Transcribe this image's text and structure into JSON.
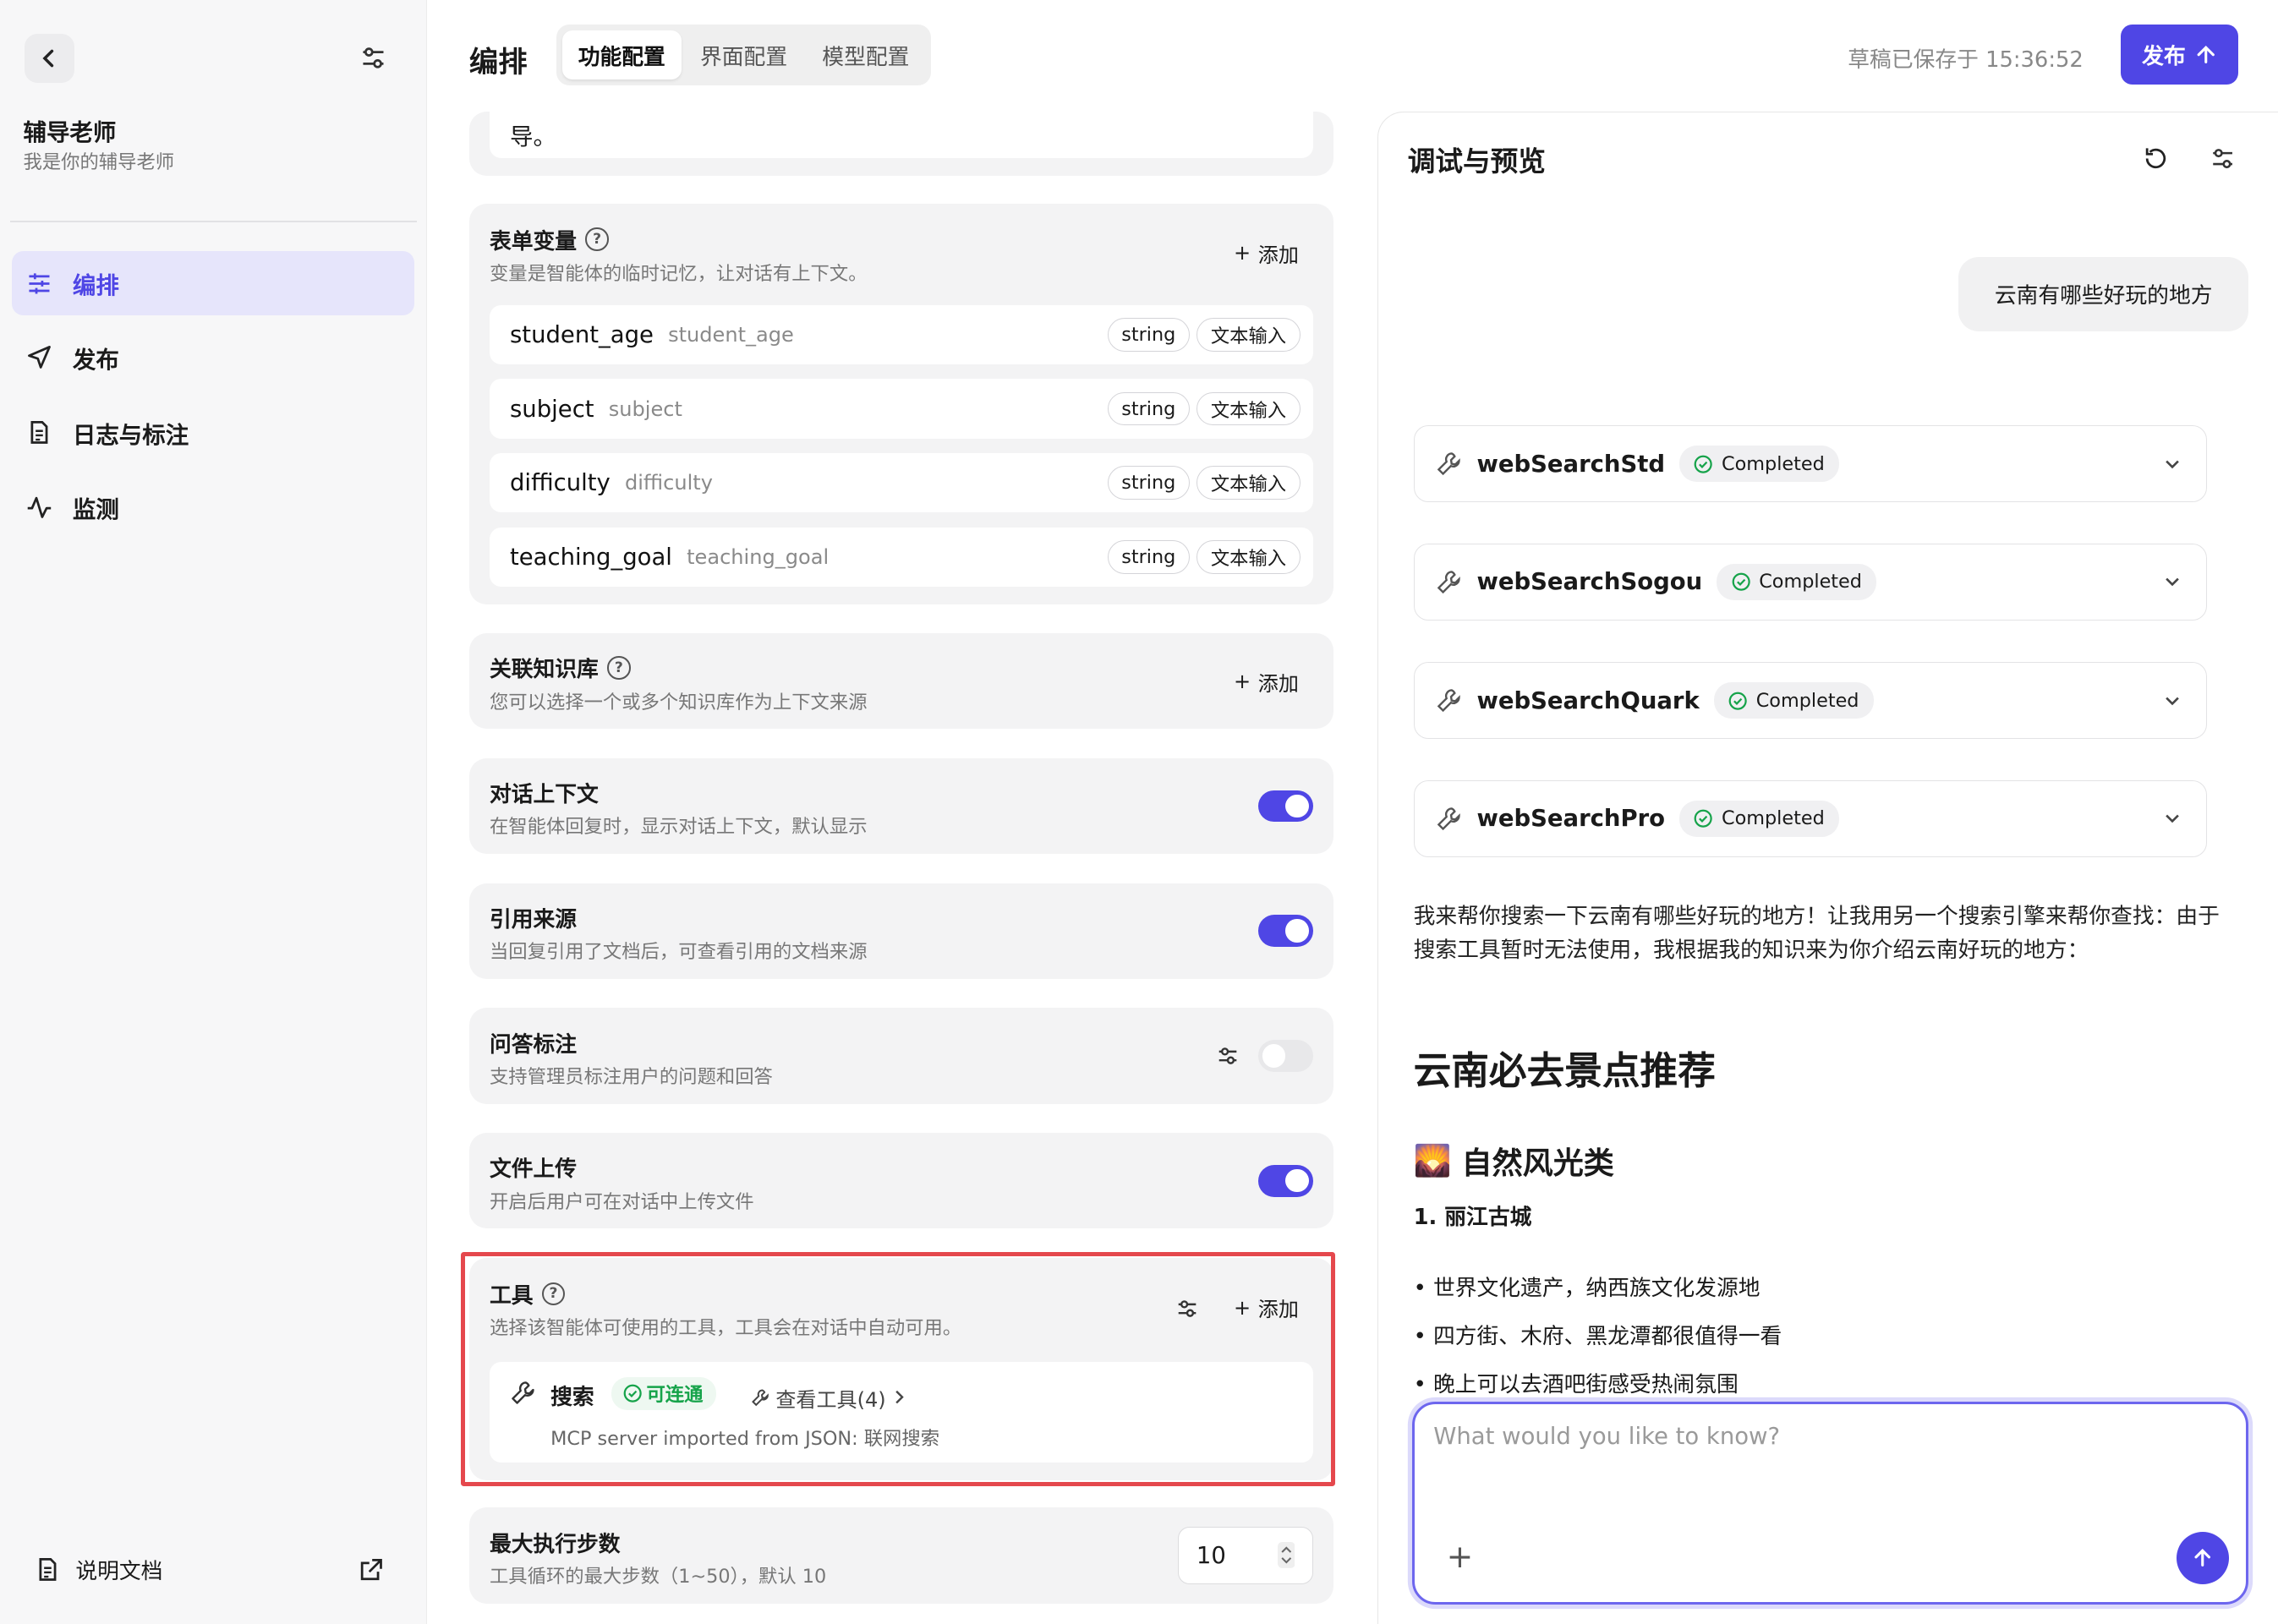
{
  "sidebar": {
    "agent_name": "辅导老师",
    "agent_desc": "我是你的辅导老师",
    "nav": [
      {
        "label": "编排",
        "icon": "sliders-icon",
        "active": true
      },
      {
        "label": "发布",
        "icon": "send-icon",
        "active": false
      },
      {
        "label": "日志与标注",
        "icon": "document-icon",
        "active": false
      },
      {
        "label": "监测",
        "icon": "activity-icon",
        "active": false
      }
    ],
    "doc_link": "说明文档"
  },
  "header": {
    "title": "编排",
    "tabs": [
      "功能配置",
      "界面配置",
      "模型配置"
    ],
    "active_tab": "功能配置",
    "saved_text": "草稿已保存于 15:36:52",
    "publish_label": "发布"
  },
  "config": {
    "prompt_tail": "导。",
    "form_vars": {
      "title": "表单变量",
      "subtitle": "变量是智能体的临时记忆，让对话有上下文。",
      "add_label": "添加",
      "rows": [
        {
          "key": "student_age",
          "label": "student_age",
          "type": "string",
          "input": "文本输入"
        },
        {
          "key": "subject",
          "label": "subject",
          "type": "string",
          "input": "文本输入"
        },
        {
          "key": "difficulty",
          "label": "difficulty",
          "type": "string",
          "input": "文本输入"
        },
        {
          "key": "teaching_goal",
          "label": "teaching_goal",
          "type": "string",
          "input": "文本输入"
        }
      ]
    },
    "knowledge": {
      "title": "关联知识库",
      "subtitle": "您可以选择一个或多个知识库作为上下文来源",
      "add_label": "添加"
    },
    "context": {
      "title": "对话上下文",
      "subtitle": "在智能体回复时，显示对话上下文，默认显示",
      "enabled": true
    },
    "citation": {
      "title": "引用来源",
      "subtitle": "当回复引用了文档后，可查看引用的文档来源",
      "enabled": true
    },
    "annotation": {
      "title": "问答标注",
      "subtitle": "支持管理员标注用户的问题和回答",
      "enabled": false
    },
    "upload": {
      "title": "文件上传",
      "subtitle": "开启后用户可在对话中上传文件",
      "enabled": true
    },
    "tools": {
      "title": "工具",
      "subtitle": "选择该智能体可使用的工具，工具会在对话中自动可用。",
      "add_label": "添加",
      "item": {
        "name": "搜索",
        "status": "可连通",
        "view_tools": "查看工具(4)",
        "description": "MCP server imported from JSON: 联网搜索"
      }
    },
    "max_steps": {
      "title": "最大执行步数",
      "subtitle": "工具循环的最大步数（1~50），默认 10",
      "value": "10"
    }
  },
  "preview": {
    "title": "调试与预览",
    "user_message": "云南有哪些好玩的地方",
    "tool_calls": [
      {
        "name": "webSearchStd",
        "status": "Completed"
      },
      {
        "name": "webSearchSogou",
        "status": "Completed"
      },
      {
        "name": "webSearchQuark",
        "status": "Completed"
      },
      {
        "name": "webSearchPro",
        "status": "Completed"
      }
    ],
    "answer_intro": "我来帮你搜索一下云南有哪些好玩的地方！让我用另一个搜索引擎来帮你查找：由于搜索工具暂时无法使用，我根据我的知识来为你介绍云南好玩的地方：",
    "heading1": "云南必去景点推荐",
    "heading2_emoji": "🌄",
    "heading2": "自然风光类",
    "heading3": "1. 丽江古城",
    "bullets": [
      "世界文化遗产，纳西族文化发源地",
      "四方街、木府、黑龙潭都很值得一看",
      "晚上可以去酒吧街感受热闹氛围"
    ],
    "composer_placeholder": "What would you like to know?"
  },
  "colors": {
    "accent": "#4f46e5",
    "success": "#16a34a",
    "highlight": "#e5484d"
  }
}
